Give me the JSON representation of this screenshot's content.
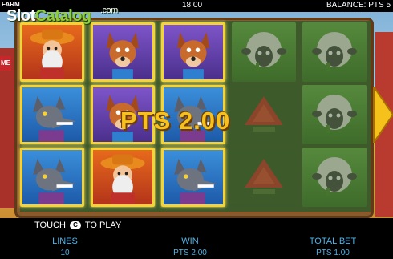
{
  "topbar": {
    "game_abbrev": "FARM",
    "clock": "18:00",
    "balance": "BALANCE: PTS 5"
  },
  "logo": {
    "slot": "Slot",
    "catalog": "Catalog",
    "com": ".com"
  },
  "side_tag": {
    "text": "ME"
  },
  "reels": [
    {
      "symbols": [
        "farmer",
        "wolf",
        "wolf"
      ],
      "highlighted": [
        true,
        true,
        true
      ]
    },
    {
      "symbols": [
        "dog",
        "dog",
        "farmer"
      ],
      "highlighted": [
        true,
        true,
        true
      ]
    },
    {
      "symbols": [
        "dog",
        "wolf",
        "wolf"
      ],
      "highlighted": [
        true,
        true,
        true
      ]
    },
    {
      "symbols": [
        "sheep",
        "barn",
        "barn"
      ],
      "highlighted": [
        false,
        false,
        false
      ]
    },
    {
      "symbols": [
        "sheep",
        "sheep",
        "sheep"
      ],
      "highlighted": [
        false,
        false,
        false
      ]
    }
  ],
  "win_display": "PTS 2.00",
  "touch_prompt": {
    "before": "TOUCH",
    "key": "C",
    "after": "TO PLAY"
  },
  "stats": {
    "lines": {
      "label": "LINES",
      "value": "10"
    },
    "win": {
      "label": "WIN",
      "value": "PTS 2.00"
    },
    "total_bet": {
      "label": "TOTAL BET",
      "value": "PTS 1.00"
    }
  },
  "colors": {
    "highlight": "#f3d335",
    "win_text": "#f6c01d",
    "stat_text": "#4fb3e8"
  }
}
